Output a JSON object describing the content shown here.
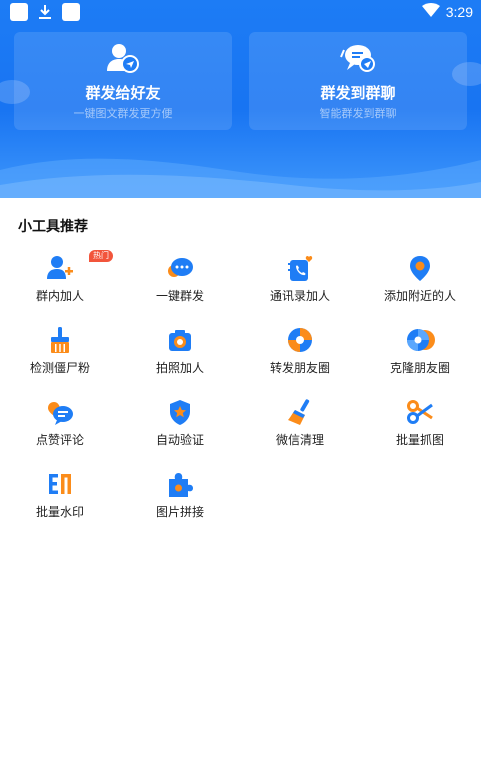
{
  "status_bar": {
    "time": "3:29"
  },
  "cards": [
    {
      "title": "群发给好友",
      "subtitle": "一键图文群发更方便",
      "icon": "users-send-icon"
    },
    {
      "title": "群发到群聊",
      "subtitle": "智能群发到群聊",
      "icon": "chat-send-icon"
    }
  ],
  "section_title": "小工具推荐",
  "tools": [
    {
      "label": "群内加人",
      "icon": "group-add-icon",
      "badge": "热门"
    },
    {
      "label": "一键群发",
      "icon": "chat-bubble-icon"
    },
    {
      "label": "通讯录加人",
      "icon": "contacts-icon"
    },
    {
      "label": "添加附近的人",
      "icon": "location-pin-icon"
    },
    {
      "label": "检测僵尸粉",
      "icon": "broom-icon"
    },
    {
      "label": "拍照加人",
      "icon": "camera-icon"
    },
    {
      "label": "转发朋友圈",
      "icon": "moments-share-icon"
    },
    {
      "label": "克隆朋友圈",
      "icon": "moments-clone-icon"
    },
    {
      "label": "点赞评论",
      "icon": "like-comment-icon"
    },
    {
      "label": "自动验证",
      "icon": "shield-star-icon"
    },
    {
      "label": "微信清理",
      "icon": "clean-brush-icon"
    },
    {
      "label": "批量抓图",
      "icon": "scissors-icon"
    },
    {
      "label": "批量水印",
      "icon": "watermark-icon"
    },
    {
      "label": "图片拼接",
      "icon": "puzzle-icon"
    }
  ],
  "colors": {
    "primary": "#1874f2",
    "accent": "#fb8c1a",
    "badge": "#f2553b"
  }
}
